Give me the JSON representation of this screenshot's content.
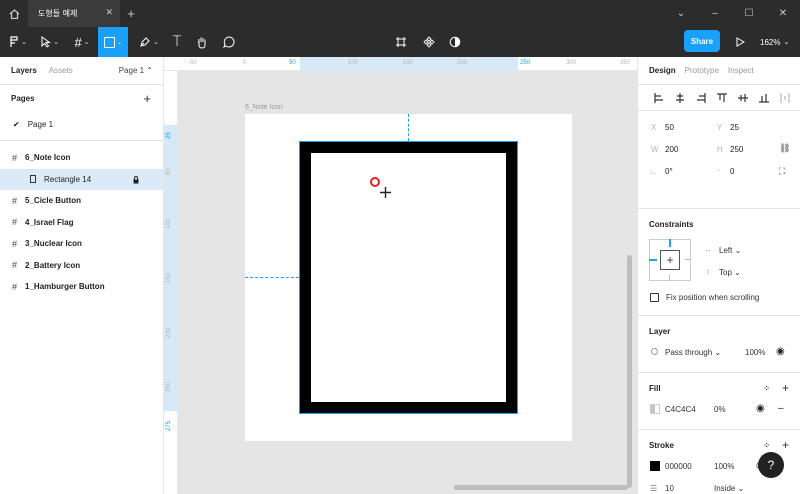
{
  "titlebar": {
    "tab_title": "도형들 예제",
    "colors": {
      "bg": "#2c2c2c",
      "active_tab": "#3b3b3b"
    }
  },
  "toolbar": {
    "share_label": "Share",
    "zoom": "162%",
    "accent": "#18a0fb"
  },
  "left_panel": {
    "tab_layers": "Layers",
    "tab_assets": "Assets",
    "page_selector": "Page 1",
    "pages_heading": "Pages",
    "pages": [
      "Page 1"
    ],
    "layers": [
      {
        "name": "6_Note Icon",
        "type": "frame"
      },
      {
        "name": "Rectangle 14",
        "type": "rectangle",
        "selected": true,
        "locked": true
      },
      {
        "name": "5_Cicle Button",
        "type": "frame"
      },
      {
        "name": "4_Israel Flag",
        "type": "frame"
      },
      {
        "name": "3_Nuclear Icon",
        "type": "frame"
      },
      {
        "name": "2_Battery Icon",
        "type": "frame"
      },
      {
        "name": "1_Hamburger Button",
        "type": "frame"
      }
    ]
  },
  "rulers": {
    "h_ticks": [
      "-50",
      "0",
      "50",
      "100",
      "150",
      "200",
      "250",
      "300",
      "350"
    ],
    "h_highlight": [
      "50",
      "250"
    ],
    "v_ticks": [
      "0",
      "25",
      "50",
      "100",
      "150",
      "200",
      "250",
      "275"
    ],
    "v_highlight": [
      "25",
      "275"
    ]
  },
  "canvas": {
    "frame_label": "6_Note Icon",
    "selection_color": "#18a0fb",
    "stroke_color": "#000000"
  },
  "right_panel": {
    "tabs": [
      "Design",
      "Prototype",
      "Inspect"
    ],
    "x_label": "X",
    "x_value": "50",
    "y_label": "Y",
    "y_value": "25",
    "w_label": "W",
    "w_value": "200",
    "h_label": "H",
    "h_value": "250",
    "rotation": "0°",
    "radius": "0",
    "constraints_title": "Constraints",
    "constraint_h": "Left",
    "constraint_v": "Top",
    "fix_position": "Fix position when scrolling",
    "layer_title": "Layer",
    "blend_mode": "Pass through",
    "layer_opacity": "100%",
    "fill_title": "Fill",
    "fill_hex": "C4C4C4",
    "fill_opacity": "0%",
    "stroke_title": "Stroke",
    "stroke_hex": "000000",
    "stroke_opacity": "100%",
    "stroke_weight": "10",
    "stroke_align": "Inside"
  },
  "help_label": "?"
}
